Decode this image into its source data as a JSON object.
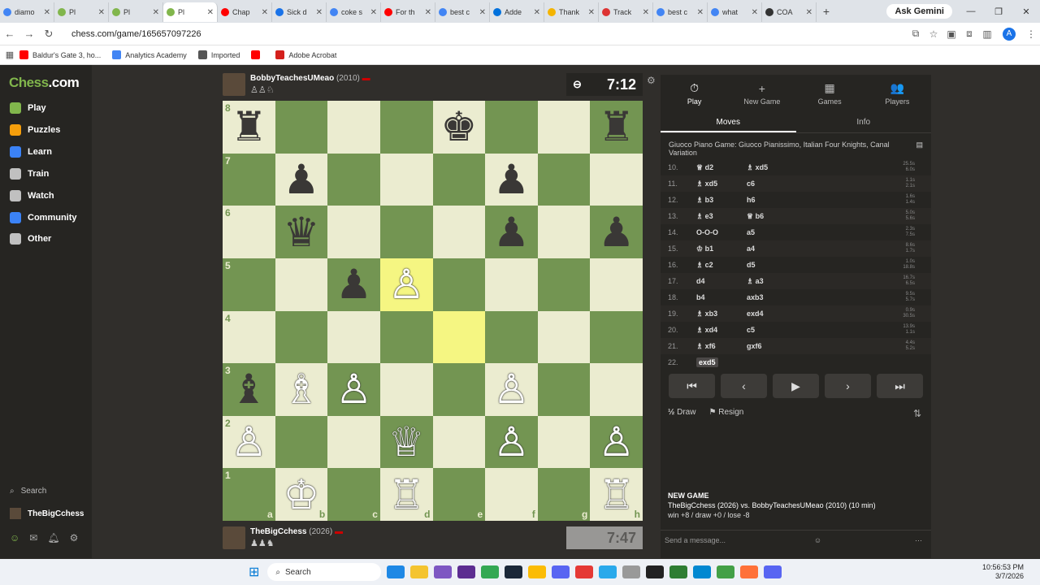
{
  "browser": {
    "tabs": [
      {
        "label": "diamo",
        "color": "#4285f4"
      },
      {
        "label": "Pl",
        "color": "#81b64c"
      },
      {
        "label": "Pl",
        "color": "#81b64c"
      },
      {
        "label": "Pl",
        "color": "#81b64c",
        "active": true
      },
      {
        "label": "Chap",
        "color": "#ff0000"
      },
      {
        "label": "Sick d",
        "color": "#1a73e8"
      },
      {
        "label": "coke s",
        "color": "#4285f4"
      },
      {
        "label": "For th",
        "color": "#ff0000"
      },
      {
        "label": "best c",
        "color": "#4285f4"
      },
      {
        "label": "Adde",
        "color": "#0071dc"
      },
      {
        "label": "Thank",
        "color": "#f4b400"
      },
      {
        "label": "Track",
        "color": "#d33"
      },
      {
        "label": "best c",
        "color": "#4285f4"
      },
      {
        "label": "what",
        "color": "#4285f4"
      },
      {
        "label": "COA",
        "color": "#333"
      }
    ],
    "gemini": "Ask Gemini",
    "url": "chess.com/game/165657097226",
    "bookmarks": [
      {
        "label": "Baldur's Gate 3, ho...",
        "color": "#ff0000"
      },
      {
        "label": "Analytics Academy",
        "color": "#4285f4"
      },
      {
        "label": "Imported",
        "color": "#555"
      },
      {
        "label": "",
        "color": "#ff0000"
      },
      {
        "label": "Adobe Acrobat",
        "color": "#d4201c"
      }
    ]
  },
  "leftnav": {
    "logo_a": "Chess",
    "logo_b": ".com",
    "items": [
      {
        "label": "Play",
        "color": "#81b64c"
      },
      {
        "label": "Puzzles",
        "color": "#f59e0b"
      },
      {
        "label": "Learn",
        "color": "#3b82f6"
      },
      {
        "label": "Train",
        "color": "#c0c0c0"
      },
      {
        "label": "Watch",
        "color": "#c0c0c0"
      },
      {
        "label": "Community",
        "color": "#3b82f6"
      },
      {
        "label": "Other",
        "color": "#c0c0c0"
      }
    ],
    "search": "Search",
    "user": "TheBigCchess"
  },
  "top_player": {
    "name": "BobbyTeachesUMeao",
    "rating": "(2010)",
    "clock": "7:12"
  },
  "bottom_player": {
    "name": "TheBigCchess",
    "rating": "(2026)",
    "clock": "7:47"
  },
  "board": {
    "ranks": [
      "8",
      "7",
      "6",
      "5",
      "4",
      "3",
      "2",
      "1"
    ],
    "files": [
      "a",
      "b",
      "c",
      "d",
      "e",
      "f",
      "g",
      "h"
    ],
    "rows": [
      [
        "♜",
        "",
        "",
        "",
        "♚",
        "",
        "",
        "♜"
      ],
      [
        "",
        "♟",
        "",
        "",
        "",
        "♟",
        "",
        ""
      ],
      [
        "",
        "♛",
        "",
        "",
        "",
        "♟",
        "",
        "♟"
      ],
      [
        "",
        "",
        "♟",
        "♙",
        "",
        "",
        "",
        ""
      ],
      [
        "",
        "",
        "",
        "",
        "",
        "",
        "",
        ""
      ],
      [
        "♝",
        "♗",
        "♙",
        "",
        "",
        "♙",
        "",
        ""
      ],
      [
        "♙",
        "",
        "",
        "♕",
        "",
        "♙",
        "",
        "♙"
      ],
      [
        "",
        "♔",
        "",
        "♖",
        "",
        "",
        "",
        "♖"
      ]
    ],
    "highlight": [
      "d5",
      "e4"
    ]
  },
  "panel": {
    "tabs": [
      {
        "label": "Play",
        "icon": "⏱",
        "active": true
      },
      {
        "label": "New Game",
        "icon": "+"
      },
      {
        "label": "Games",
        "icon": "▦"
      },
      {
        "label": "Players",
        "icon": "👥"
      }
    ],
    "subtabs": [
      {
        "label": "Moves",
        "active": true
      },
      {
        "label": "Info"
      }
    ],
    "opening": "Giuoco Piano Game: Giuoco Pianissimo, Italian Four Knights, Canal Variation",
    "moves": [
      {
        "n": "10.",
        "w": "♕ d2",
        "b": "♗ xd5",
        "t1": "25.5s",
        "t2": "6.0s"
      },
      {
        "n": "11.",
        "w": "♗ xd5",
        "b": "c6",
        "t1": "1.1s",
        "t2": "2.1s"
      },
      {
        "n": "12.",
        "w": "♗ b3",
        "b": "h6",
        "t1": "1.6s",
        "t2": "1.4s"
      },
      {
        "n": "13.",
        "w": "♗ e3",
        "b": "♕ b6",
        "t1": "5.0s",
        "t2": "5.6s"
      },
      {
        "n": "14.",
        "w": "O-O-O",
        "b": "a5",
        "t1": "2.3s",
        "t2": "7.5s"
      },
      {
        "n": "15.",
        "w": "♔ b1",
        "b": "a4",
        "t1": "8.6s",
        "t2": "1.7s"
      },
      {
        "n": "16.",
        "w": "♗ c2",
        "b": "d5",
        "t1": "1.0s",
        "t2": "18.8s"
      },
      {
        "n": "17.",
        "w": "d4",
        "b": "♗ a3",
        "t1": "16.7s",
        "t2": "6.5s"
      },
      {
        "n": "18.",
        "w": "b4",
        "b": "axb3",
        "t1": "9.5s",
        "t2": "5.7s"
      },
      {
        "n": "19.",
        "w": "♗ xb3",
        "b": "exd4",
        "t1": "0.9s",
        "t2": "30.5s"
      },
      {
        "n": "20.",
        "w": "♗ xd4",
        "b": "c5",
        "t1": "13.9s",
        "t2": "1.1s"
      },
      {
        "n": "21.",
        "w": "♗ xf6",
        "b": "gxf6",
        "t1": "4.4s",
        "t2": "5.2s"
      },
      {
        "n": "22.",
        "w": "exd5",
        "b": "",
        "t1": "",
        "t2": ""
      }
    ],
    "draw": "Draw",
    "resign": "Resign",
    "newgame_title": "NEW GAME",
    "newgame_line": "TheBigCchess (2026) vs. BobbyTeachesUMeao (2010) (10 min)",
    "newgame_stats": "win +8 / draw +0 / lose -8",
    "message_placeholder": "Send a message..."
  },
  "taskbar": {
    "search": "Search",
    "time": "10:56:53 PM",
    "date": "3/7/2026"
  }
}
